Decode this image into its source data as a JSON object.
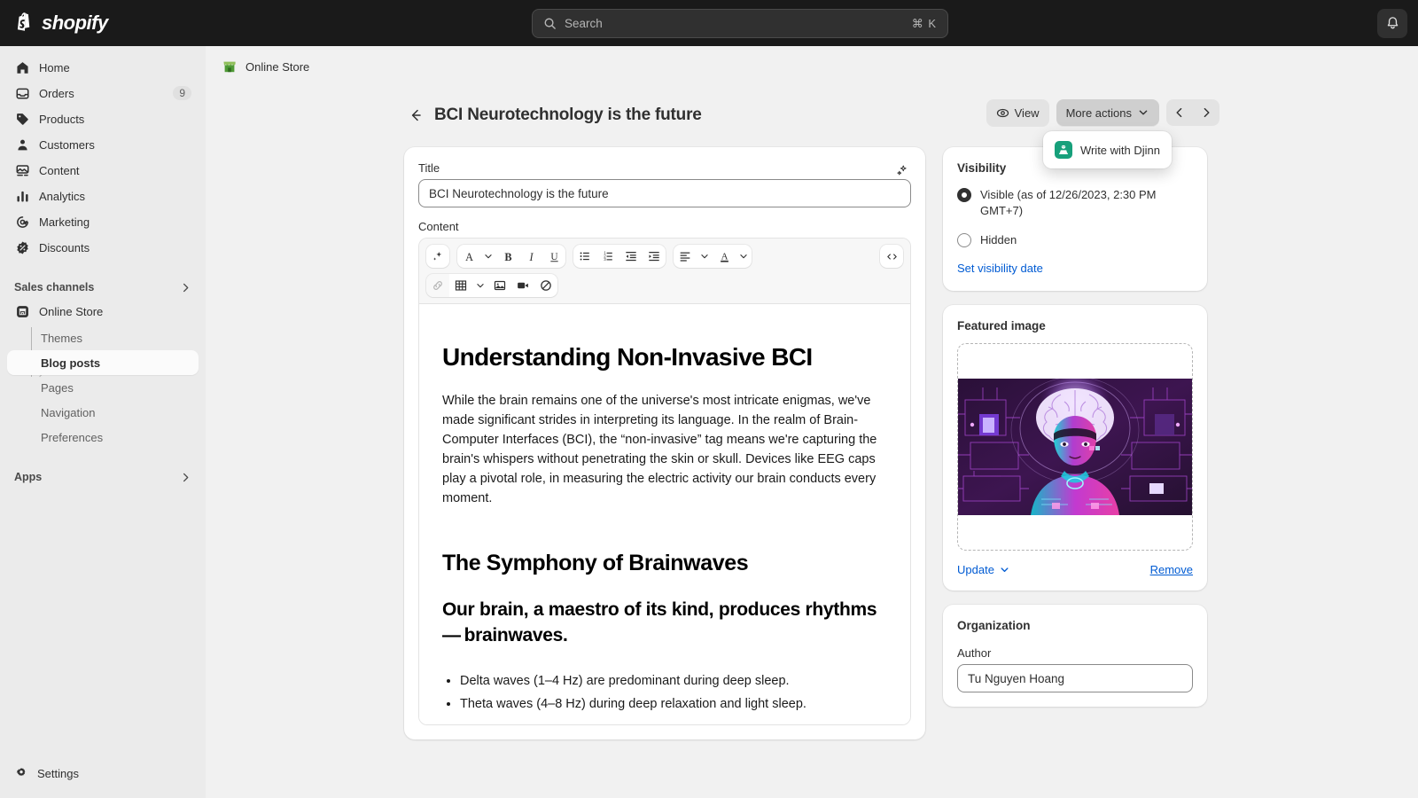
{
  "topbar": {
    "brand": "shopify",
    "search": {
      "placeholder": "Search",
      "shortcut": "⌘ K"
    },
    "notifications_icon": "bell-icon"
  },
  "sidebar": {
    "items": [
      {
        "label": "Home",
        "icon": "home-icon",
        "badge": ""
      },
      {
        "label": "Orders",
        "icon": "orders-icon",
        "badge": "9"
      },
      {
        "label": "Products",
        "icon": "products-tag-icon",
        "badge": ""
      },
      {
        "label": "Customers",
        "icon": "customers-person-icon",
        "badge": ""
      },
      {
        "label": "Content",
        "icon": "content-image-icon",
        "badge": ""
      },
      {
        "label": "Analytics",
        "icon": "analytics-bars-icon",
        "badge": ""
      },
      {
        "label": "Marketing",
        "icon": "marketing-target-icon",
        "badge": ""
      },
      {
        "label": "Discounts",
        "icon": "discounts-badge-icon",
        "badge": ""
      }
    ],
    "sales_channels_label": "Sales channels",
    "online_store_label": "Online Store",
    "subitems": [
      {
        "label": "Themes",
        "active": false
      },
      {
        "label": "Blog posts",
        "active": true
      },
      {
        "label": "Pages",
        "active": false
      },
      {
        "label": "Navigation",
        "active": false
      },
      {
        "label": "Preferences",
        "active": false
      }
    ],
    "apps_label": "Apps",
    "settings_label": "Settings"
  },
  "breadcrumb": {
    "label": "Online Store",
    "icon": "store-icon"
  },
  "page": {
    "title": "BCI Neurotechnology is the future",
    "back_icon": "arrow-left-icon",
    "actions": {
      "view_label": "View",
      "view_icon": "eye-icon",
      "more_actions_label": "More actions",
      "more_actions_icon": "chevron-down-icon",
      "prev_icon": "chevron-left-icon",
      "next_icon": "chevron-right-icon"
    },
    "dropdown": {
      "items": [
        {
          "label": "Write with Djinn",
          "icon": "djinn-icon"
        }
      ]
    }
  },
  "editor_card": {
    "title_label": "Title",
    "title_value": "BCI Neurotechnology is the future",
    "magic_icon": "magic-sparkle-icon",
    "content_label": "Content",
    "toolbar": {
      "row1": [
        {
          "icon": "magic-sparkle-icon",
          "name": "ai-assist-button"
        },
        {
          "icon": "font-size-A-icon",
          "name": "text-style-button"
        },
        {
          "icon": "chevron-down-icon",
          "name": "text-style-chevron"
        },
        {
          "icon": "bold-icon",
          "name": "bold-button"
        },
        {
          "icon": "italic-icon",
          "name": "italic-button"
        },
        {
          "icon": "underline-icon",
          "name": "underline-button"
        },
        {
          "icon": "bulleted-list-icon",
          "name": "bulleted-list-button"
        },
        {
          "icon": "numbered-list-icon",
          "name": "numbered-list-button"
        },
        {
          "icon": "outdent-icon",
          "name": "outdent-button"
        },
        {
          "icon": "indent-icon",
          "name": "indent-button"
        },
        {
          "icon": "align-left-icon",
          "name": "align-button"
        },
        {
          "icon": "chevron-down-icon",
          "name": "align-chevron"
        },
        {
          "icon": "text-color-A-icon",
          "name": "text-color-button"
        },
        {
          "icon": "chevron-down-icon",
          "name": "text-color-chevron"
        }
      ],
      "row2": [
        {
          "icon": "link-icon",
          "name": "insert-link-button"
        },
        {
          "icon": "table-icon",
          "name": "insert-table-button"
        },
        {
          "icon": "chevron-down-icon",
          "name": "table-chevron"
        },
        {
          "icon": "image-icon",
          "name": "insert-image-button"
        },
        {
          "icon": "video-icon",
          "name": "insert-video-button"
        },
        {
          "icon": "clear-formatting-icon",
          "name": "clear-formatting-button"
        }
      ],
      "code_view_icon": "code-view-icon"
    },
    "body": {
      "heading1": "Understanding Non-Invasive BCI",
      "paragraph1": "While the brain remains one of the universe's most intricate enigmas, we've made significant strides in interpreting its language. In the realm of Brain-Computer Interfaces (BCI), the “non-invasive” tag means we're capturing the brain's whispers without penetrating the skin or skull. Devices like EEG caps play a pivotal role, in measuring the electric activity our brain conducts every moment.",
      "heading2": "The Symphony of Brainwaves",
      "lead": "Our brain, a maestro of its kind, produces rhythms — brainwaves.",
      "bullets": [
        "Delta waves (1–4 Hz) are predominant during deep sleep.",
        "Theta waves (4–8 Hz) during deep relaxation and light sleep."
      ]
    }
  },
  "visibility_card": {
    "title": "Visibility",
    "options": [
      {
        "label": "Visible (as of 12/26/2023, 2:30 PM GMT+7)",
        "selected": true
      },
      {
        "label": "Hidden",
        "selected": false
      }
    ],
    "set_date_link": "Set visibility date"
  },
  "featured_image_card": {
    "title": "Featured image",
    "image_alt": "AI generated portrait of a woman with glowing brain and circuitry",
    "update_label": "Update",
    "update_icon": "chevron-down-icon",
    "remove_label": "Remove"
  },
  "organization_card": {
    "title": "Organization",
    "author_label": "Author",
    "author_value": "Tu Nguyen Hoang"
  },
  "colors": {
    "brand_dark": "#1a1a1a",
    "sidebar_bg": "#ebebeb",
    "page_bg": "#f1f1f1",
    "link_blue": "#005bd3",
    "djinn_green": "#17a07b"
  }
}
